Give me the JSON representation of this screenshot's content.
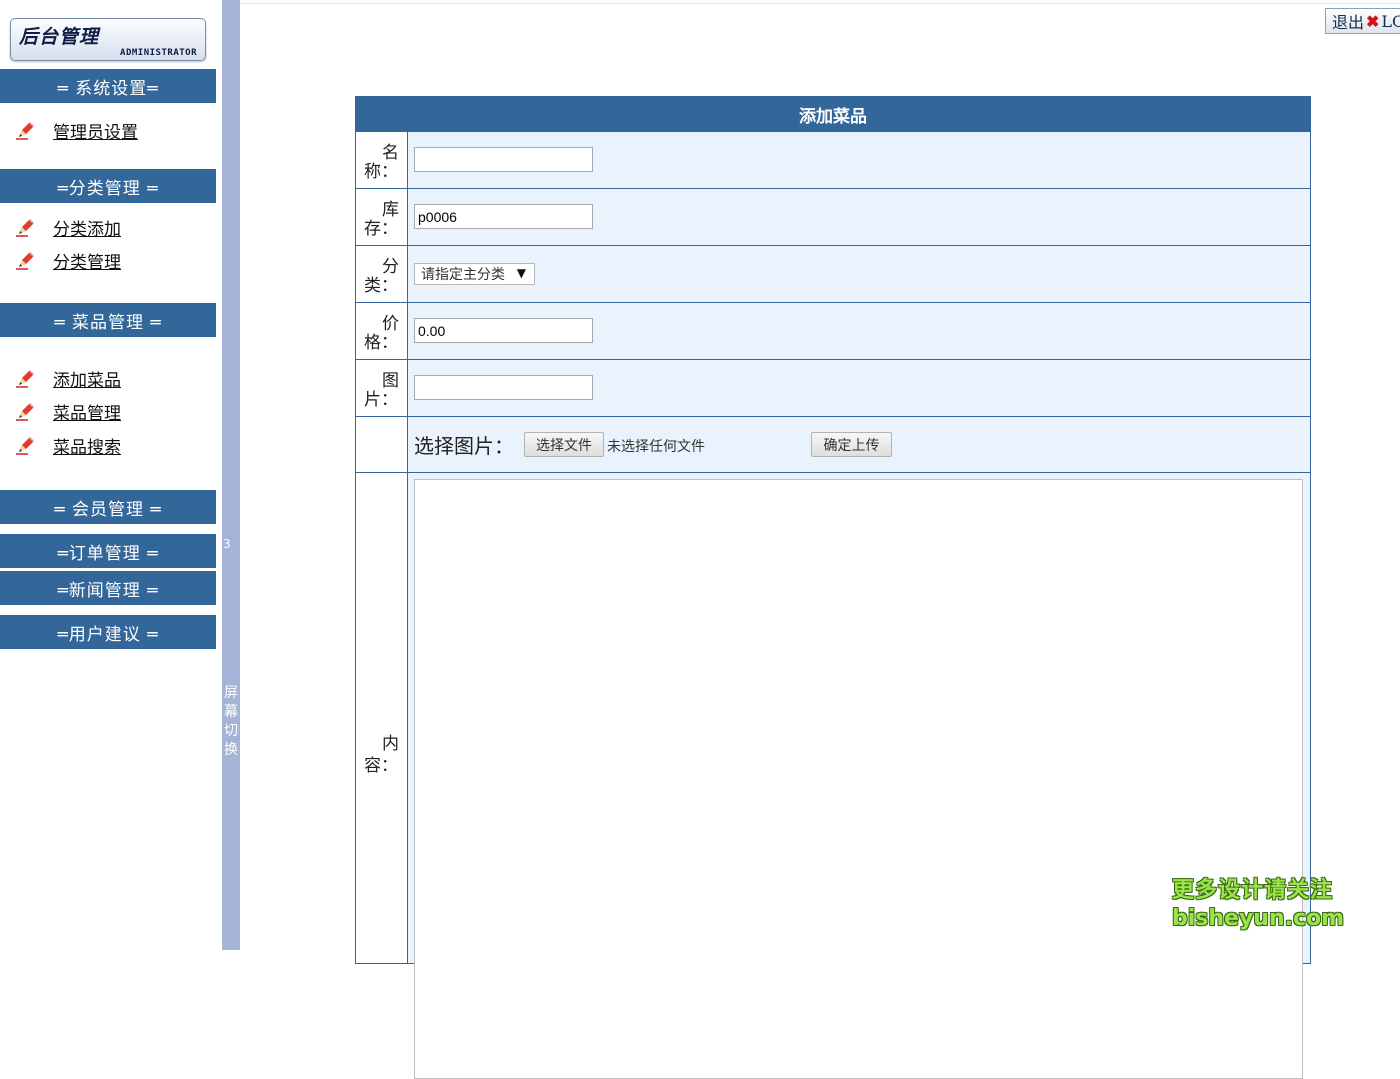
{
  "sidebar": {
    "logo_title": "后台管理",
    "logo_sub": "ADMINISTRATOR",
    "sections": [
      {
        "title": "═ 系统设置═",
        "items": [
          "管理员设置"
        ]
      },
      {
        "title": "═分类管理 ═",
        "items": [
          "分类添加",
          "分类管理"
        ]
      },
      {
        "title": "═ 菜品管理 ═",
        "items": [
          "添加菜品",
          "菜品管理",
          "菜品搜索"
        ]
      },
      {
        "title": "═ 会员管理 ═",
        "items": []
      },
      {
        "title": "═订单管理 ═",
        "items": []
      },
      {
        "title": "═新闻管理 ═",
        "items": []
      },
      {
        "title": "═用户建议 ═",
        "items": []
      }
    ]
  },
  "splitter": {
    "number": "3",
    "text": "屏幕切换"
  },
  "topbar": {
    "logout_label": "退出",
    "logout_suffix": "LO"
  },
  "form": {
    "title": "添加菜品",
    "fields": [
      {
        "l1": "名",
        "l2": "称：",
        "value": ""
      },
      {
        "l1": "库",
        "l2": "存：",
        "value": "p0006"
      },
      {
        "l1": "分",
        "l2": "类：",
        "select": "请指定主分类"
      },
      {
        "l1": "价",
        "l2": "格：",
        "value": "0.00"
      },
      {
        "l1": "图",
        "l2": "片：",
        "value": ""
      }
    ],
    "upload": {
      "label": "选择图片：",
      "choose_button": "选择文件",
      "no_file_text": "未选择任何文件",
      "upload_button": "确定上传"
    },
    "content_label_l1": "内",
    "content_label_l2": "容："
  },
  "watermark": {
    "line1": "更多设计请关注",
    "line2": "bisheyun.com"
  },
  "colors": {
    "header_blue": "#336699",
    "row_bg": "#eaf2fd",
    "splitter": "#a4b3d6"
  }
}
